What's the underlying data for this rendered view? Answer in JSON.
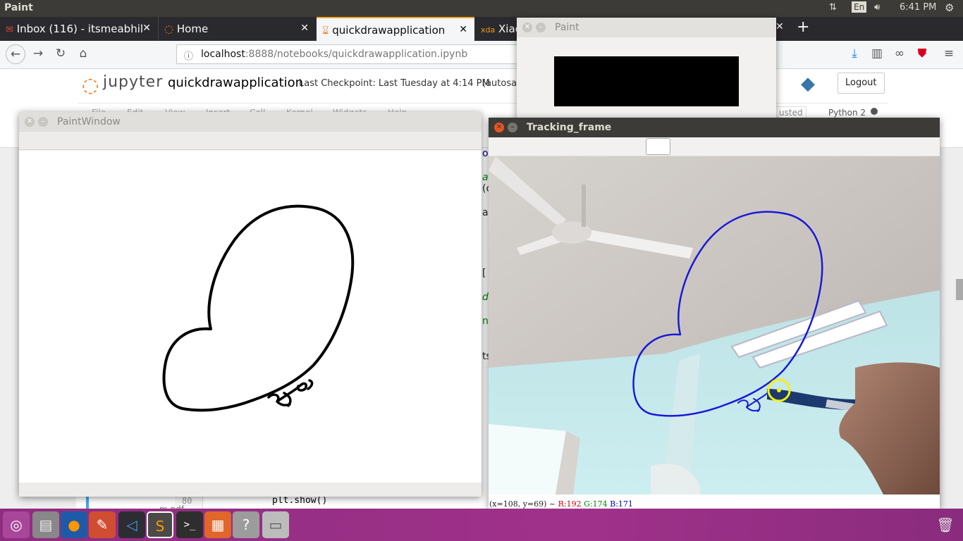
{
  "system": {
    "app_title": "Paint",
    "keyboard": "En",
    "time": "6:41 PM"
  },
  "browser": {
    "tabs": [
      {
        "label": "Inbox (116) - itsmeabhil",
        "icon": "gmail-icon"
      },
      {
        "label": "Home",
        "icon": "jupyter-icon"
      },
      {
        "label": "quickdrawapplication",
        "icon": "hourglass-icon"
      },
      {
        "label": "Xiac",
        "icon": "xda-icon"
      }
    ],
    "url_host": "localhost",
    "url_rest": ":8888/notebooks/quickdrawapplication.ipynb"
  },
  "jupyter": {
    "logo": "jupyter",
    "notebook_name": "quickdrawapplication",
    "checkpoint": "Last Checkpoint: Last Tuesday at 4:14 PM",
    "autosave": "(autosav",
    "logout": "Logout",
    "menu": [
      "File",
      "Edit",
      "View",
      "Insert",
      "Cell",
      "Kernel",
      "Widgets",
      "Help"
    ],
    "trusted": "usted",
    "kernel": "Python 2",
    "code_fragments": [
      "o",
      "a",
      "(c",
      "ac",
      "[",
      "de",
      "ne",
      "ts"
    ],
    "line_number": "80",
    "code_line": "plt.show()",
    "file_label": "m.pdf"
  },
  "windows": {
    "paint": {
      "title": "Paint"
    },
    "paint_window": {
      "title": "PaintWindow"
    },
    "tracking": {
      "title": "Tracking_frame",
      "status": {
        "coords": "(x=108, y=69) ~",
        "r": "R:192",
        "g": "G:174",
        "b": "B:171"
      }
    }
  },
  "colors": {
    "drawing_black": "#000000",
    "tracking_blue": "#1a1ad6",
    "marker_yellow": "#f5f20a",
    "titlebar": "#3c3b37",
    "close_orange": "#e95420"
  },
  "dock": {
    "apps": [
      {
        "icon": "ubuntu-logo-icon"
      },
      {
        "icon": "files-icon"
      },
      {
        "icon": "firefox-icon"
      },
      {
        "icon": "settings-icon"
      },
      {
        "icon": "vscode-icon"
      },
      {
        "icon": "sublime-icon"
      },
      {
        "icon": "terminal-icon"
      },
      {
        "icon": "impress-icon"
      },
      {
        "icon": "help-icon"
      },
      {
        "icon": "drive-icon"
      }
    ],
    "trash": "trash-icon"
  }
}
